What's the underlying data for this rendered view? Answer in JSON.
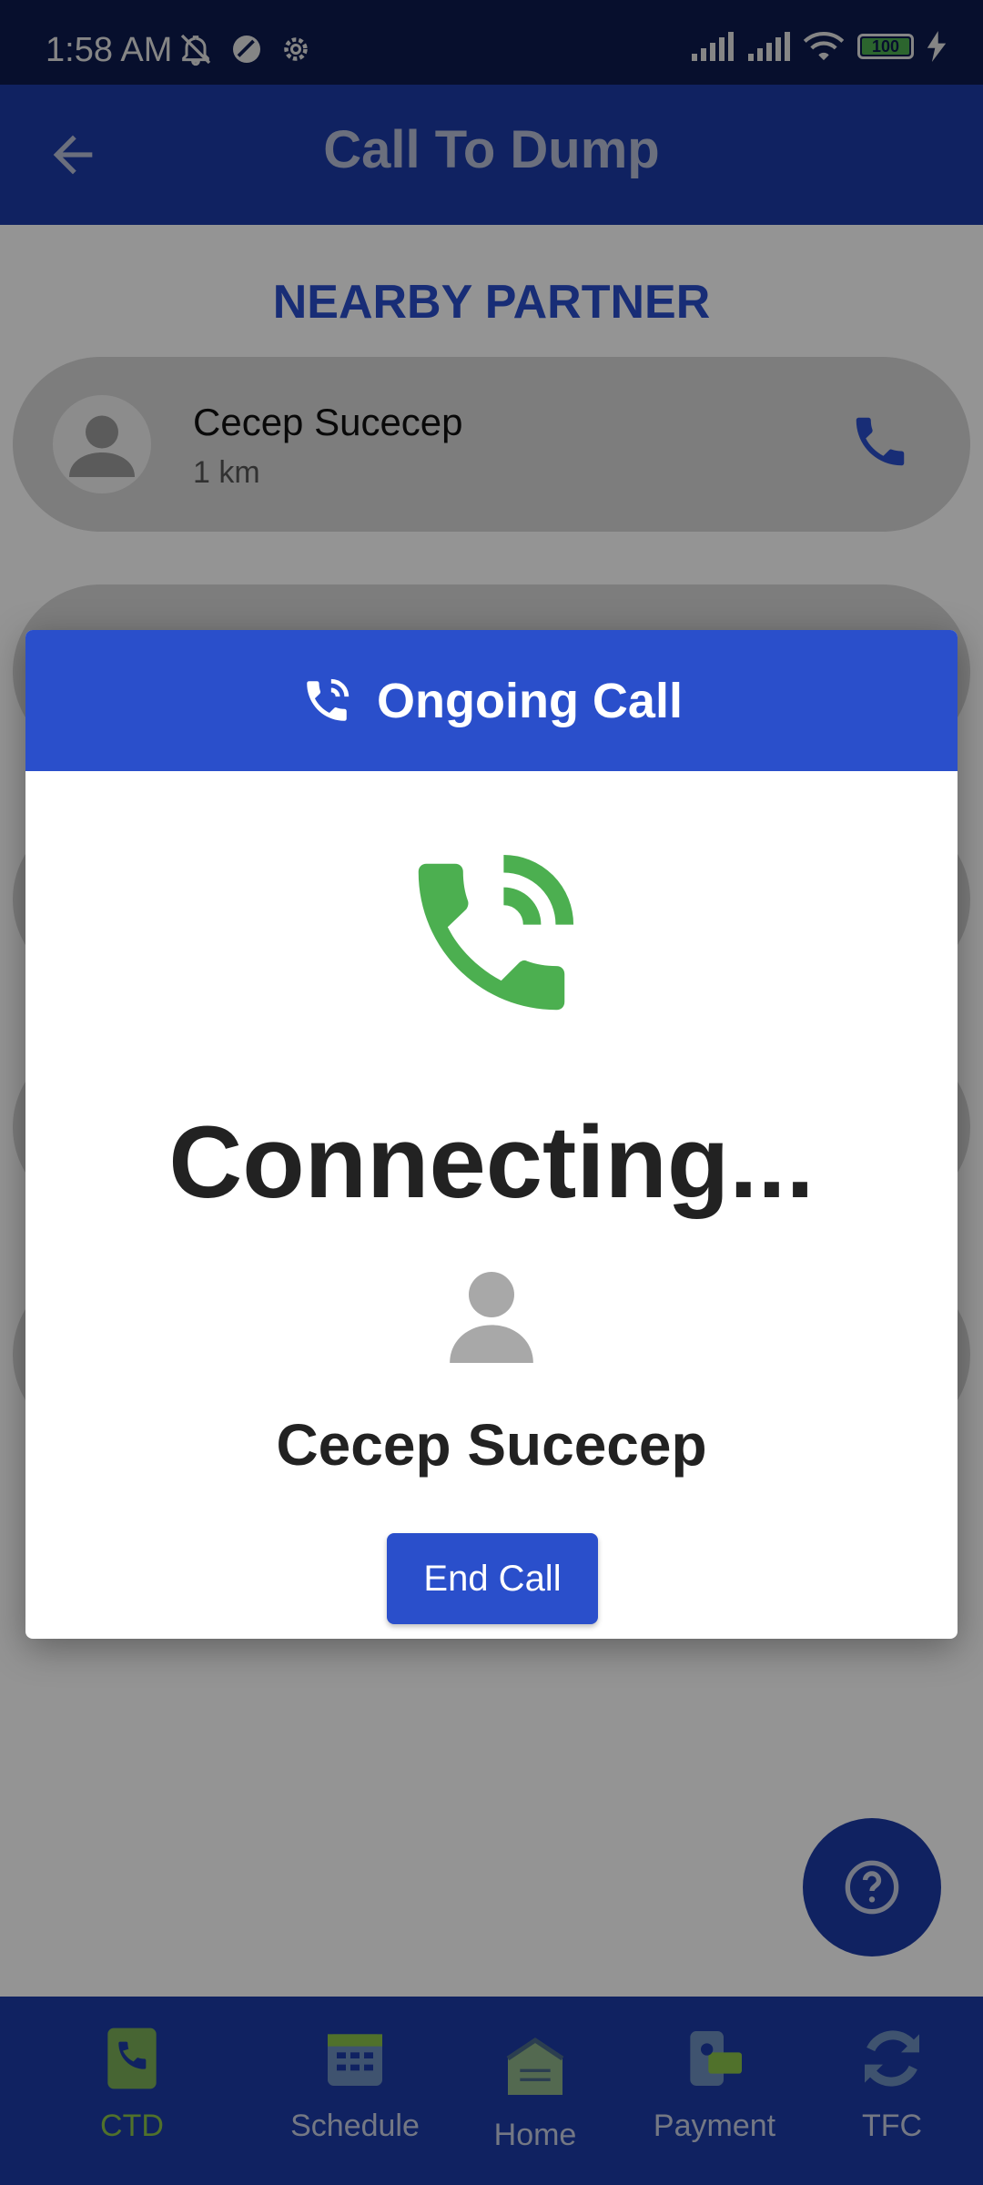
{
  "status_bar": {
    "time": "1:58 AM",
    "battery": "100",
    "icons": [
      "mute-icon",
      "moon-icon",
      "gear-icon",
      "signal-icon",
      "signal-icon",
      "wifi-icon",
      "battery-icon",
      "charging-icon"
    ]
  },
  "app_bar": {
    "title": "Call To Dump",
    "back_icon": "arrow-left-icon"
  },
  "content": {
    "section_title": "NEARBY PARTNER",
    "partners": [
      {
        "name": "Cecep Sucecep",
        "distance": "1 km"
      }
    ]
  },
  "modal": {
    "title": "Ongoing Call",
    "status": "Connecting...",
    "callee": "Cecep Sucecep",
    "end_call_label": "End Call"
  },
  "bottom_nav": {
    "items": [
      {
        "label": "CTD",
        "icon": "phone-book-icon",
        "active": true
      },
      {
        "label": "Schedule",
        "icon": "calendar-icon",
        "active": false
      },
      {
        "label": "Home",
        "icon": "home-icon",
        "active": false
      },
      {
        "label": "Payment",
        "icon": "payment-icon",
        "active": false
      },
      {
        "label": "TFC",
        "icon": "refresh-icon",
        "active": false
      }
    ]
  },
  "colors": {
    "primary": "#1d3ba8",
    "accent": "#2a4fcb",
    "call_green": "#4caf50",
    "active_nav": "#8bc34a"
  }
}
